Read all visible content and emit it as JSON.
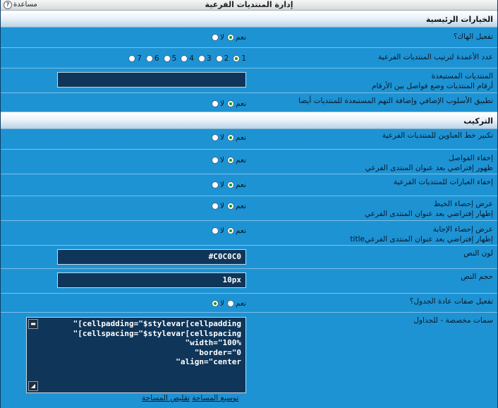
{
  "window": {
    "title": "إدارة المنتديات الفرعية",
    "help_label": "مساعدة",
    "help_icon": "question-icon"
  },
  "sections": {
    "main": "الخيارات الرئيسية",
    "layout": "التركيب"
  },
  "rows": {
    "enable_hack": {
      "label": "تفعيل الهاك؟",
      "yes": "نعم",
      "no": "لا",
      "selected": "yes"
    },
    "columns": {
      "label": "عدد الأعمدة لترتيب المنتديات الفرعية",
      "options": [
        "1",
        "2",
        "3",
        "4",
        "5",
        "6",
        "7"
      ],
      "selected": "1"
    },
    "excluded": {
      "label": "المنتديات المستبعدة",
      "sub": "أرقام المنتديات وضع فواصل بين الأرقام",
      "value": ""
    },
    "apply_style": {
      "label": "تطبيق الأسلوب الإضافي وإضافة التهم المستبعدة للمنتديات أيضا",
      "yes": "نعم",
      "no": "لا",
      "selected": "yes"
    },
    "bold_titles": {
      "label": "تكبير خط العناوين للمنتديات الفرعية",
      "yes": "نعم",
      "no": "لا",
      "selected": "yes"
    },
    "hide_separators": {
      "label": "إخفاء الفواصل",
      "sub": "ظهور إفتراضي بعد عنوان المنتدى الفرعي",
      "yes": "نعم",
      "no": "لا",
      "selected": "yes"
    },
    "hide_phrases": {
      "label": "إخفاء العبارات للمنتديات الفرعية",
      "yes": "نعم",
      "no": "لا",
      "selected": "yes"
    },
    "thread_count": {
      "label": "عرض إحصاء الخيط",
      "sub": "إظهار إفتراضي بعد عنوان المنتدى الفرعي",
      "yes": "نعم",
      "no": "لا",
      "selected": "yes"
    },
    "reply_count": {
      "label": "عرض إحصاء الإجابة",
      "sub": "إظهار إفتراضي بعد عنوان المنتدى الفرعيtitle",
      "yes": "نعم",
      "no": "لا",
      "selected": "yes"
    },
    "text_color": {
      "label": "لون النص",
      "value": "#C0C0C0"
    },
    "text_size": {
      "label": "حجم النص",
      "value": "10px"
    },
    "table_attrs": {
      "label": "تفعيل صفات عادة الجدول؟",
      "yes": "نعم",
      "no": "لا",
      "selected": "no"
    },
    "custom_attrs": {
      "label": "سمات مخصصة - للجداول",
      "value": "\"[cellpadding=\"$stylevar[cellpadding\n\"[cellspacing=\"$stylevar[cellspacing\n\"width=\"100%\n\"border=\"0\n\"align=\"center",
      "expand": "توسيع المساحة",
      "shrink": "تقليص المساحة"
    }
  }
}
